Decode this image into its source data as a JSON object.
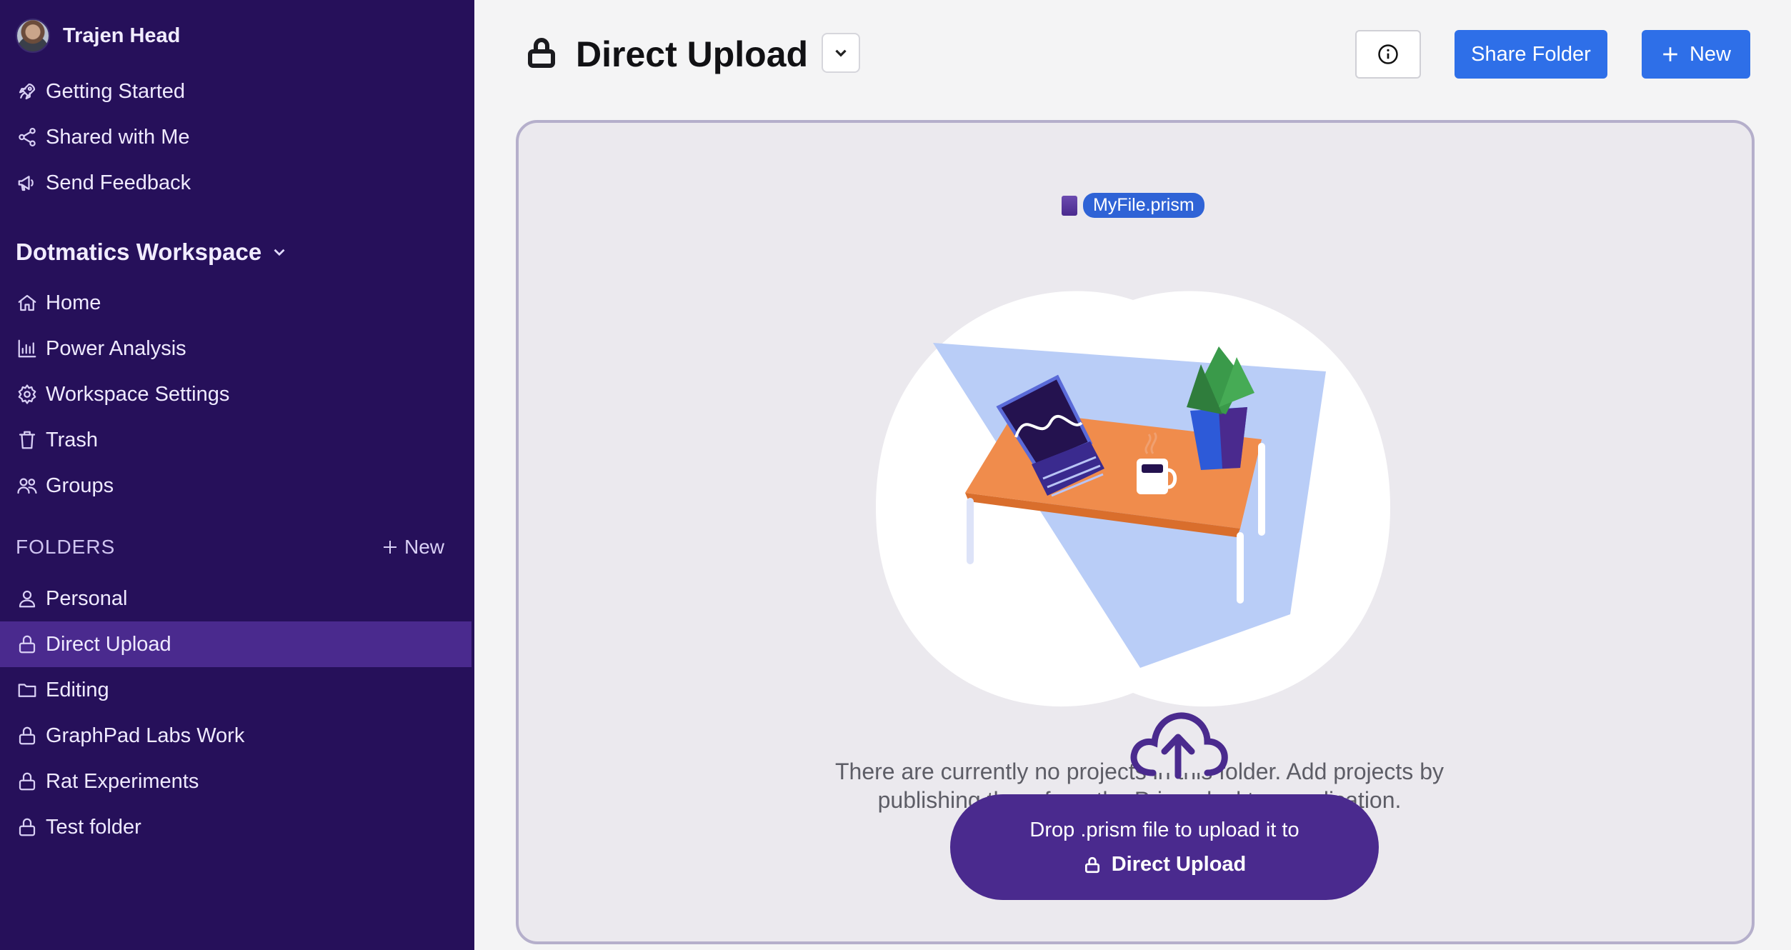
{
  "user": {
    "name": "Trajen Head"
  },
  "sidebar": {
    "top_items": [
      {
        "label": "Getting Started",
        "icon": "rocket-icon"
      },
      {
        "label": "Shared with Me",
        "icon": "share-icon"
      },
      {
        "label": "Send Feedback",
        "icon": "megaphone-icon"
      }
    ],
    "workspace": {
      "name": "Dotmatics Workspace"
    },
    "workspace_items": [
      {
        "label": "Home",
        "icon": "home-icon"
      },
      {
        "label": "Power Analysis",
        "icon": "bar-chart-icon"
      },
      {
        "label": "Workspace Settings",
        "icon": "gear-icon"
      },
      {
        "label": "Trash",
        "icon": "trash-icon"
      },
      {
        "label": "Groups",
        "icon": "group-icon"
      }
    ],
    "folders_heading": "FOLDERS",
    "folders_new_label": "New",
    "folders": [
      {
        "label": "Personal",
        "icon": "user-icon"
      },
      {
        "label": "Direct Upload",
        "icon": "lock-icon",
        "active": true
      },
      {
        "label": "Editing",
        "icon": "folder-icon"
      },
      {
        "label": "GraphPad Labs Work",
        "icon": "lock-icon"
      },
      {
        "label": "Rat Experiments",
        "icon": "lock-icon"
      },
      {
        "label": "Test folder",
        "icon": "lock-icon"
      }
    ]
  },
  "header": {
    "title": "Direct Upload",
    "share_label": "Share Folder",
    "new_label": "New"
  },
  "main": {
    "dragged_file": "MyFile.prism",
    "empty_line1": "There are currently no projects in this folder. Add projects by",
    "empty_line2": "publishing them from the Prism desktop application.",
    "upload_line1": "Drop .prism file to upload it to",
    "upload_target": "Direct Upload"
  },
  "colors": {
    "sidebar_bg": "#26105a",
    "sidebar_active": "#4a2a8e",
    "primary_button": "#2e6fe8",
    "upload_pill": "#4a2a8e"
  }
}
